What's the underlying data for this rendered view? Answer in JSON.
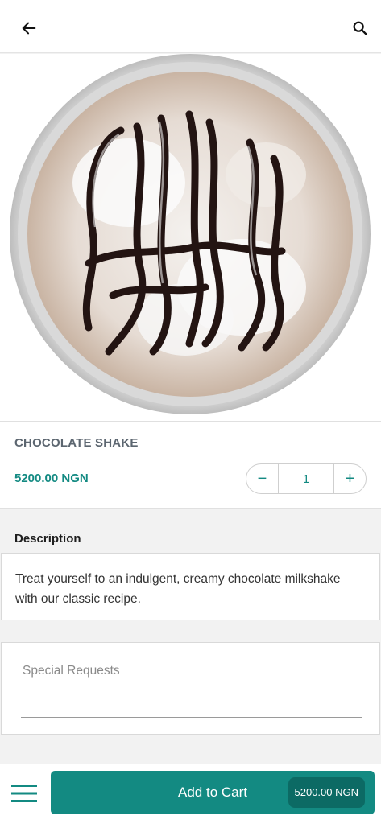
{
  "header": {
    "back_icon": "arrow-left-icon",
    "search_icon": "search-icon"
  },
  "product": {
    "name": "CHOCOLATE SHAKE",
    "price": "5200.00 NGN",
    "quantity": "1",
    "decrement_label": "−",
    "increment_label": "+"
  },
  "description": {
    "heading": "Description",
    "text": "Treat yourself to an indulgent, creamy chocolate milkshake with our classic recipe."
  },
  "special_requests": {
    "placeholder": "Special Requests",
    "value": ""
  },
  "footer": {
    "menu_icon": "hamburger-menu-icon",
    "add_to_cart_label": "Add to Cart",
    "cart_total": "5200.00 NGN"
  },
  "colors": {
    "accent": "#138a82",
    "accent_dark": "#0c6a64",
    "background": "#f2f2f2"
  }
}
